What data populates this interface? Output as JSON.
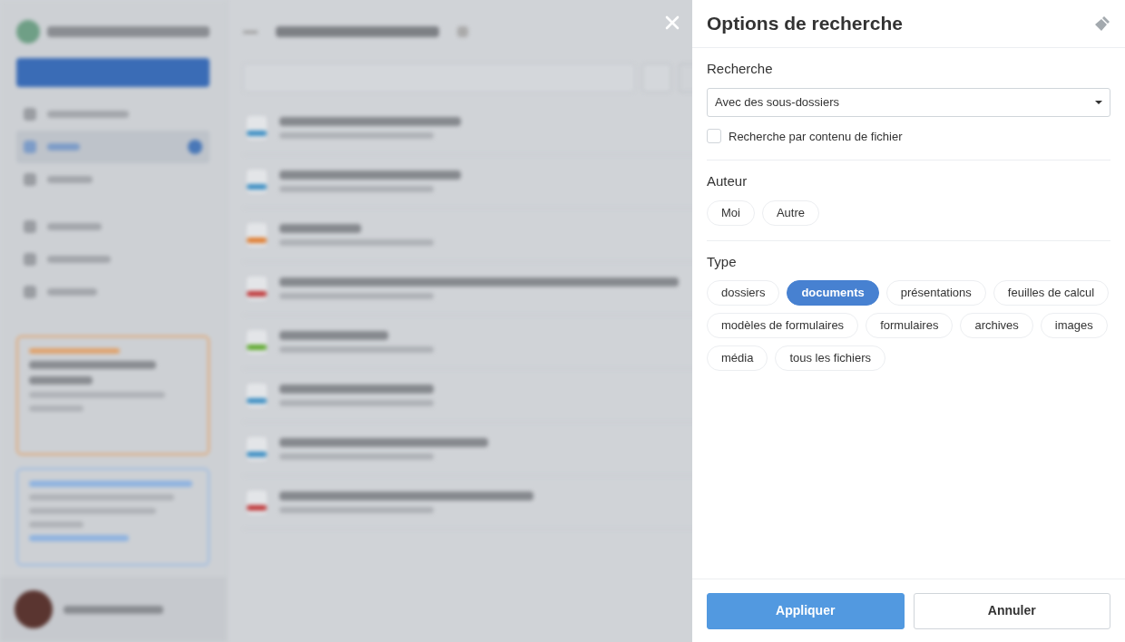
{
  "panel": {
    "title": "Options de recherche",
    "sections": [
      {
        "heading": "Recherche",
        "kind": "search",
        "dropdown": "Avec des sous-dossiers",
        "checkbox": {
          "label": "Recherche par contenu de fichier",
          "checked": false
        }
      },
      {
        "heading": "Auteur",
        "kind": "chips",
        "chips": [
          {
            "label": "Moi",
            "selected": false
          },
          {
            "label": "Autre",
            "selected": false
          }
        ]
      },
      {
        "heading": "Type",
        "kind": "chips",
        "chips": [
          {
            "label": "dossiers",
            "selected": false
          },
          {
            "label": "documents",
            "selected": true
          },
          {
            "label": "présentations",
            "selected": false
          },
          {
            "label": "feuilles de calcul",
            "selected": false
          },
          {
            "label": "modèles de formulaires",
            "selected": false
          },
          {
            "label": "formulaires",
            "selected": false
          },
          {
            "label": "archives",
            "selected": false
          },
          {
            "label": "images",
            "selected": false
          },
          {
            "label": "média",
            "selected": false
          },
          {
            "label": "tous les fichiers",
            "selected": false
          }
        ]
      }
    ],
    "buttons": [
      {
        "label": "Appliquer",
        "kind": "primary"
      },
      {
        "label": "Annuler",
        "kind": "secondary"
      }
    ]
  }
}
